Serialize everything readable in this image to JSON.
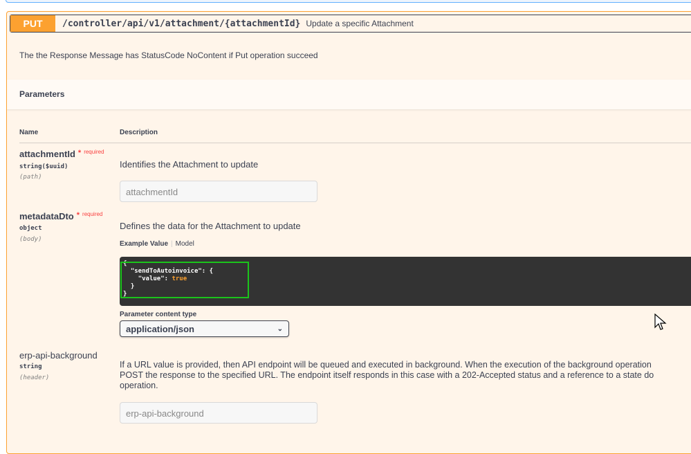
{
  "operation": {
    "method": "PUT",
    "path": "/controller/api/v1/attachment/{attachmentId}",
    "summary": "Update a specific Attachment",
    "description": "The the Response Message has StatusCode NoContent if Put operation succeed",
    "color": "#fca130"
  },
  "parameters": {
    "title": "Parameters",
    "col_name": "Name",
    "col_description": "Description",
    "items": [
      {
        "name": "attachmentId",
        "required_star": "*",
        "required": "required",
        "type": "string($uuid)",
        "in": "(path)",
        "description": "Identifies the Attachment to update",
        "placeholder": "attachmentId"
      },
      {
        "name": "metadataDto",
        "required_star": "*",
        "required": "required",
        "type": "object",
        "in": "(body)",
        "description": "Defines the data for the Attachment to update",
        "example_tab": "Example Value",
        "model_tab": "Model",
        "code": {
          "open": "{",
          "key": "\"sendToAutoinvoice\"",
          "inner_key": "\"value\"",
          "inner_value": "true",
          "close_inner": "}",
          "close": "}"
        },
        "content_type_label": "Parameter content type",
        "content_type": "application/json"
      },
      {
        "name": "erp-api-background",
        "type": "string",
        "in": "(header)",
        "description_lines": [
          "If a URL value is provided, then API endpoint will be queued and executed in background. When the execution of the background operation",
          "POST the response to the specified URL. The endpoint itself responds in this case with a 202-Accepted status and a reference to a state do",
          "operation."
        ],
        "placeholder": "erp-api-background"
      }
    ]
  }
}
